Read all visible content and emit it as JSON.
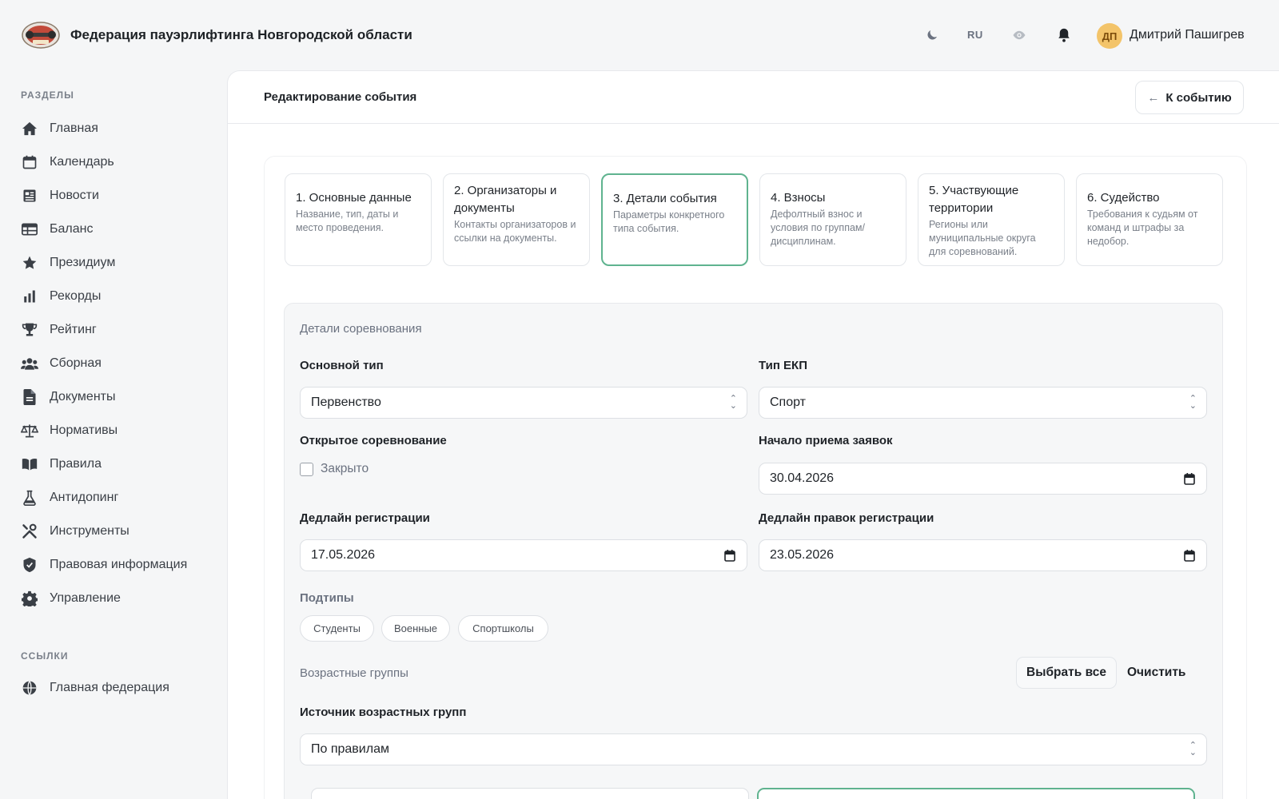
{
  "app": {
    "title": "Федерация пауэрлифтинга Новгородской области",
    "lang": "RU",
    "user_initials": "ДП",
    "user_name": "Дмитрий Пашигрев"
  },
  "sidebar": {
    "sections_label": "РАЗДЕЛЫ",
    "items": [
      {
        "label": "Главная",
        "icon": "home-icon"
      },
      {
        "label": "Календарь",
        "icon": "calendar-icon"
      },
      {
        "label": "Новости",
        "icon": "news-icon"
      },
      {
        "label": "Баланс",
        "icon": "table-icon"
      },
      {
        "label": "Президиум",
        "icon": "star-icon"
      },
      {
        "label": "Рекорды",
        "icon": "bar-chart-icon"
      },
      {
        "label": "Рейтинг",
        "icon": "trophy-icon"
      },
      {
        "label": "Сборная",
        "icon": "users-icon"
      },
      {
        "label": "Документы",
        "icon": "document-icon"
      },
      {
        "label": "Нормативы",
        "icon": "scales-icon"
      },
      {
        "label": "Правила",
        "icon": "book-icon"
      },
      {
        "label": "Антидопинг",
        "icon": "flask-icon"
      },
      {
        "label": "Инструменты",
        "icon": "tools-icon"
      },
      {
        "label": "Правовая информация",
        "icon": "shield-icon"
      },
      {
        "label": "Управление",
        "icon": "gear-icon"
      }
    ],
    "links_label": "ССЫЛКИ",
    "links": [
      {
        "label": "Главная федерация",
        "icon": "globe-icon"
      }
    ]
  },
  "page": {
    "title": "Редактирование события",
    "back_label": "К событию"
  },
  "steps": [
    {
      "title": "1. Основные данные",
      "desc": "Название, тип, даты и место проведения."
    },
    {
      "title": "2. Организаторы и документы",
      "desc": "Контакты организаторов и ссылки на документы."
    },
    {
      "title": "3. Детали события",
      "desc": "Параметры конкретного типа события."
    },
    {
      "title": "4. Взносы",
      "desc": "Дефолтный взнос и условия по группам/дисциплинам."
    },
    {
      "title": "5. Участвующие территории",
      "desc": "Регионы или муниципальные округа для соревнований."
    },
    {
      "title": "6. Судейство",
      "desc": "Требования к судьям от команд и штрафы за недобор."
    }
  ],
  "details": {
    "section_title": "Детали соревнования",
    "main_type_label": "Основной тип",
    "main_type_value": "Первенство",
    "ekp_type_label": "Тип ЕКП",
    "ekp_type_value": "Спорт",
    "open_label": "Открытое соревнование",
    "open_checkbox_label": "Закрыто",
    "reg_start_label": "Начало приема заявок",
    "reg_start_value": "30.04.2026",
    "reg_deadline_label": "Дедлайн регистрации",
    "reg_deadline_value": "17.05.2026",
    "reg_edit_deadline_label": "Дедлайн правок регистрации",
    "reg_edit_deadline_value": "23.05.2026",
    "subtypes_label": "Подтипы",
    "subtypes": [
      "Студенты",
      "Военные",
      "Спортшколы"
    ],
    "age_groups_label": "Возрастные группы",
    "select_all_label": "Выбрать все",
    "clear_label": "Очистить",
    "age_source_label": "Источник возрастных групп",
    "age_source_value": "По правилам"
  },
  "colors": {
    "accent": "#5fb38f",
    "avatar_bg": "#f3c46a"
  }
}
